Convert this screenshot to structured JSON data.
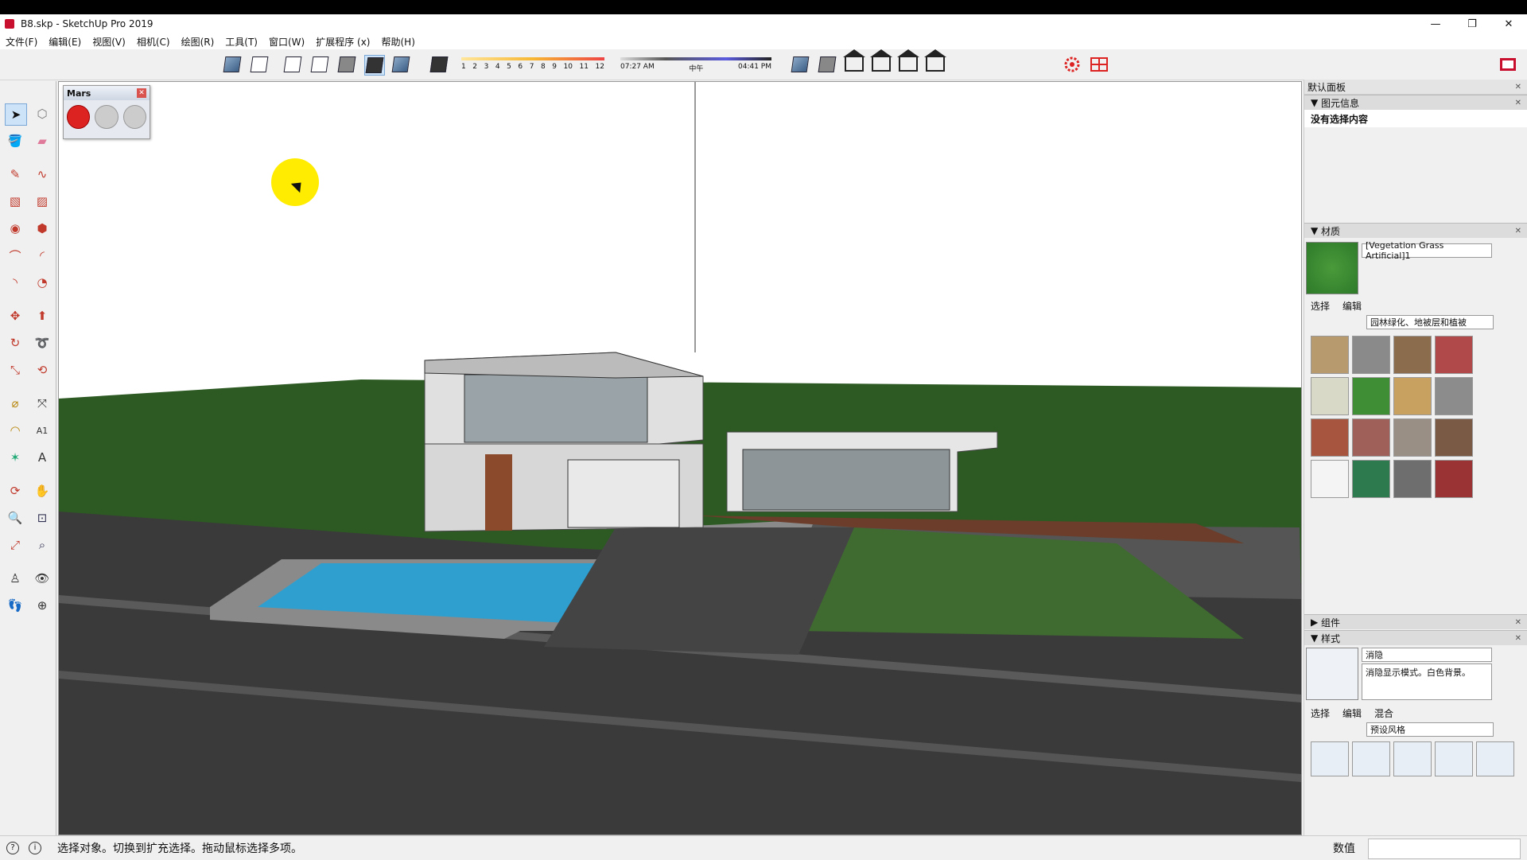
{
  "window": {
    "title": "B8.skp - SketchUp Pro 2019",
    "controls": [
      "—",
      "❐",
      "✕"
    ]
  },
  "menu": [
    "文件(F)",
    "编辑(E)",
    "视图(V)",
    "相机(C)",
    "绘图(R)",
    "工具(T)",
    "窗口(W)",
    "扩展程序 (x)",
    "帮助(H)"
  ],
  "shadow_scale": {
    "numbers": [
      "1",
      "2",
      "3",
      "4",
      "5",
      "6",
      "7",
      "8",
      "9",
      "10",
      "11",
      "12"
    ]
  },
  "time_bar": {
    "start": "07:27 AM",
    "mid": "中午",
    "end": "04:41 PM"
  },
  "mars_panel": {
    "title": "Mars"
  },
  "right_panel": {
    "title": "默认面板",
    "entity_info": {
      "section": "图元信息",
      "text": "没有选择内容"
    },
    "materials": {
      "section": "材质",
      "name": "[Vegetation Grass Artificial]1",
      "tabs": [
        "选择",
        "编辑"
      ],
      "library": "园林绿化、地被层和植被"
    },
    "components": {
      "section": "组件"
    },
    "styles": {
      "section": "样式",
      "name": "消隐",
      "description": "消隐显示模式。白色背景。",
      "tabs": [
        "选择",
        "编辑",
        "混合"
      ],
      "library": "预设风格"
    }
  },
  "status": {
    "message": "选择对象。切换到扩充选择。拖动鼠标选择多项。",
    "value_label": "数值"
  },
  "colors": {
    "grass": "#3f6b30",
    "ground": "#2d5a23",
    "pool": "#2f9fd0",
    "road": "#333333",
    "accent": "#c8102e"
  }
}
